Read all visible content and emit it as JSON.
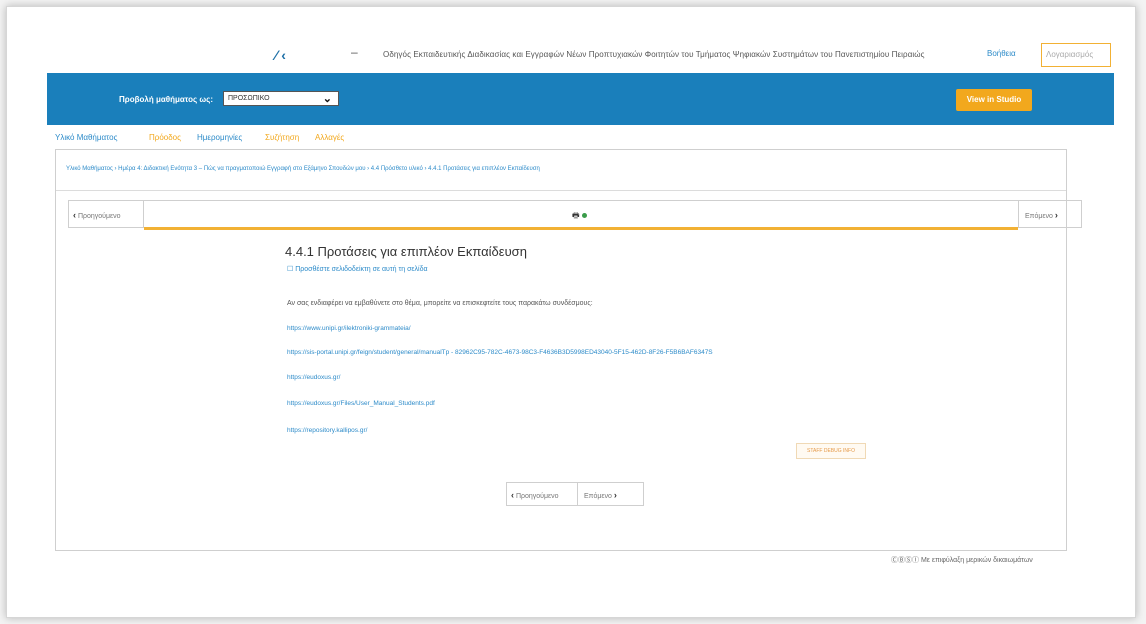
{
  "header": {
    "logo_text": "⁄ ‹",
    "dash": "–",
    "course_title": "Οδηγός Εκπαιδευτικής Διαδικασίας και Εγγραφών Νέων Προπτυχιακών Φοιτητών του Τμήματος Ψηφιακών Συστημάτων του Πανεπιστημίου Πειραιώς",
    "help_link": "Βοήθεια",
    "account": "Λογαριασμός"
  },
  "viewbar": {
    "label": "Προβολή μαθήματος ως:",
    "select_value": "ΠΡΟΣΩΠΙΚΟ",
    "studio_button": "View in Studio"
  },
  "tabs": [
    {
      "label": "Υλικό Μαθήματος",
      "color": "#2d8bc9"
    },
    {
      "label": "Πρόοδος",
      "color": "#f2a81d"
    },
    {
      "label": "Ημερομηνίες",
      "color": "#2d8bc9"
    },
    {
      "label": "Συζήτηση",
      "color": "#f2a81d"
    },
    {
      "label": "Αλλαγές",
      "color": "#f2a81d"
    }
  ],
  "breadcrumb": "Υλικό Μαθήματος  ›  Ημέρα 4: Διδακτική Ενότητα 3 – Πώς να πραγματοποιώ Εγγραφή στο Εξάμηνο Σπουδών μου  ›  4.4 Πρόσθετο υλικό  ›  4.4.1 Προτάσεις για επιπλέον Εκπαίδευση",
  "sequence": {
    "prev": "Προηγούμενο",
    "next": "Επόμενο",
    "unit_icon": "🖶"
  },
  "unit": {
    "title": "4.4.1 Προτάσεις για επιπλέον Εκπαίδευση",
    "bookmark": "Προσθέστε σελιδοδείκτη σε αυτή τη σελίδα",
    "intro": "Αν σας ενδιαφέρει να εμβαθύνετε στο θέμα, μπορείτε να επισκεφτείτε τους παρακάτω συνδέσμους:",
    "links": [
      "https://www.unipi.gr/ilektroniki-grammateia/",
      "https://sis-portal.unipi.gr/feign/student/general/manualTp - 82962C95-782C-4673-98C3-F4636B3D5998ED43040-5F15-462D-8F26-F5B6BAF6347S",
      "https://eudoxus.gr/",
      "https://eudoxus.gr/Files/User_Manual_Students.pdf",
      "https://repository.kallipos.gr/"
    ],
    "staff_debug": "STAFF DEBUG INFO"
  },
  "bottom_nav": {
    "prev": "Προηγούμενο",
    "next": "Επόμενο"
  },
  "license": "ⒸⒷⓈⒾ Με επιφύλαξη μερικών δικαιωμάτων"
}
